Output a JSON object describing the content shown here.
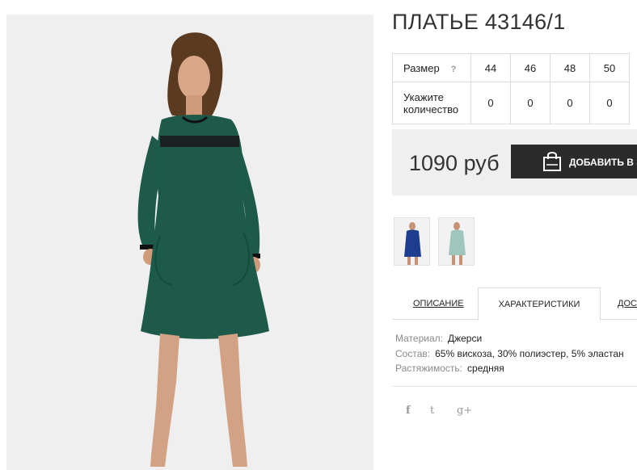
{
  "product": {
    "title": "ПЛАТЬЕ 43146/1",
    "main_photo": "green-dress-photo",
    "dress_color": "#1d5a4a",
    "accent_color": "#111111"
  },
  "size_table": {
    "size_label": "Размер",
    "help_icon": "?",
    "quantity_label_line1": "Укажите",
    "quantity_label_line2": "количество",
    "sizes": [
      "44",
      "46",
      "48",
      "50"
    ],
    "quantities": [
      "0",
      "0",
      "0",
      "0"
    ]
  },
  "buy": {
    "price": "1090 руб",
    "add_label": "ДОБАВИТЬ В ЗАКАЗ",
    "icon": "shopping-bag-icon"
  },
  "thumbnails": [
    {
      "name": "blue-dress-thumbnail",
      "color": "#1e3d8f"
    },
    {
      "name": "mint-dress-thumbnail",
      "color": "#9fc6bd"
    }
  ],
  "tabs": {
    "description": "ОПИСАНИЕ",
    "characteristics": "ХАРАКТЕРИСТИКИ",
    "delivery": "ДОСТАВКА"
  },
  "characteristics": {
    "material_key": "Материал:",
    "material_value": "Джерси",
    "composition_key": "Состав:",
    "composition_value": "65% вискоза, 30% полиэстер, 5% эластан",
    "stretch_key": "Растяжимость:",
    "stretch_value": "средняя"
  },
  "social": {
    "facebook": "f",
    "twitter": "t",
    "googleplus": "g+"
  }
}
